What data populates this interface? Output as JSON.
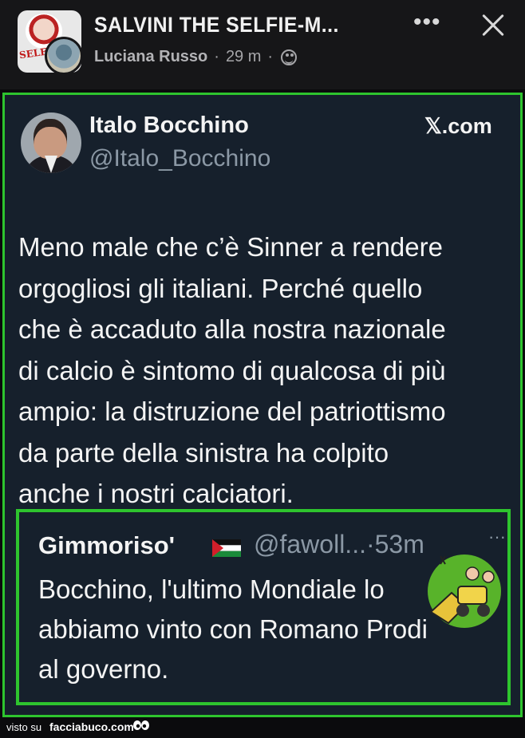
{
  "header": {
    "group_title": "SALVINI THE SELFIE-M...",
    "author": "Luciana Russo",
    "separator_1": "·",
    "time": "29 m",
    "separator_2": "·",
    "thumb_text": "SELFIE",
    "more_icon": "more-horizontal-icon",
    "close_icon": "close-icon",
    "privacy_icon": "globe-icon"
  },
  "tweet": {
    "author_name": "Italo Bocchino",
    "author_handle": "@Italo_Bocchino",
    "platform": "𝕏.com",
    "text": "Meno male che c’è Sinner a rendere\norgogliosi gli italiani. Perché quello\nche è accaduto alla nostra nazionale\ndi calcio è sintomo di qualcosa di più\nampio: la distruzione del patriottismo\nda parte della  sinistra ha colpito\nanche i nostri calciatori."
  },
  "reply": {
    "name": "Gimmoriso'",
    "handle_time": "@fawoll...·53m",
    "more": "···",
    "text": "Bocchino, l'ultimo Mondiale lo\nabbiamo vinto con Romano Prodi\nal governo."
  },
  "footer": {
    "seen_on": "visto su",
    "site": "facciabuco.com"
  },
  "colors": {
    "accent_border": "#2ec42e",
    "card_bg": "#16202c",
    "header_bg": "#161618",
    "handle_gray": "#8b98a5"
  }
}
